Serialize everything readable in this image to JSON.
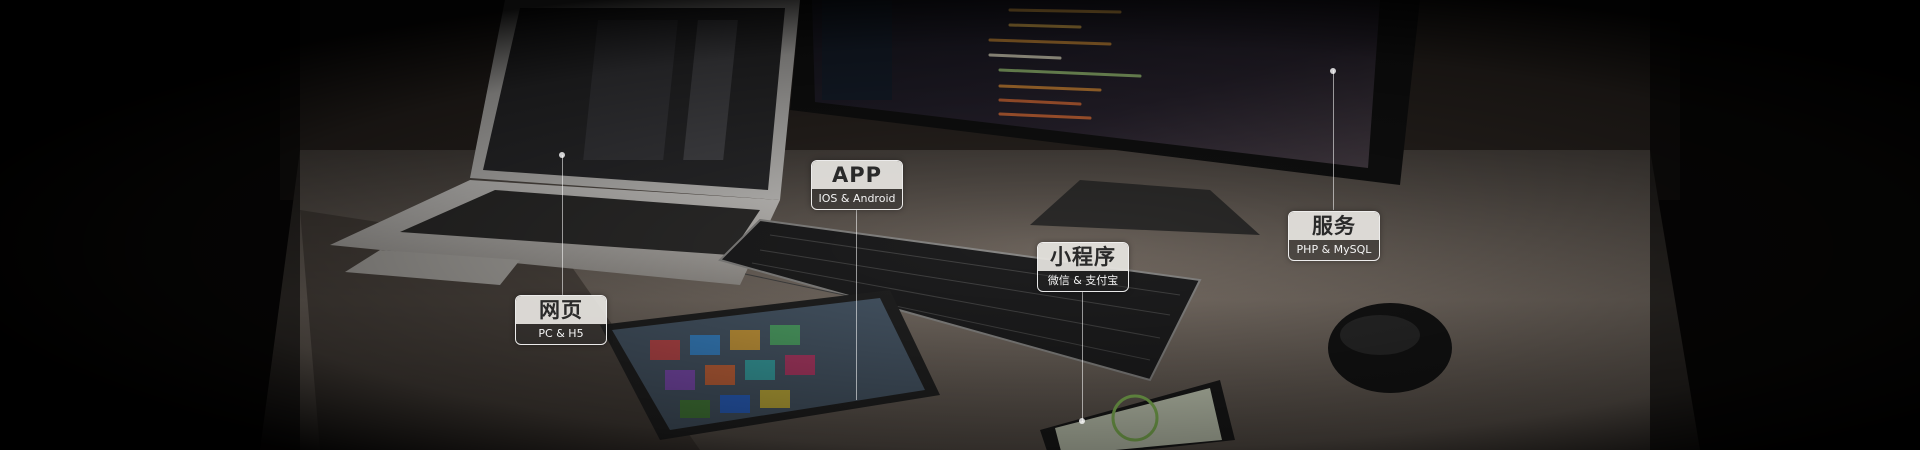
{
  "tags": {
    "web": {
      "title": "网页",
      "subtitle": "PC & H5"
    },
    "app": {
      "title": "APP",
      "subtitle": "IOS & Android"
    },
    "miniapp": {
      "title": "小程序",
      "subtitle": "微信 & 支付宝"
    },
    "service": {
      "title": "服务",
      "subtitle": "PHP & MySQL"
    }
  },
  "colors": {
    "background": "#0a0908",
    "desk": "#7b7168",
    "tag_fill": "#e6e4e0",
    "tag_border": "#ffffff"
  }
}
